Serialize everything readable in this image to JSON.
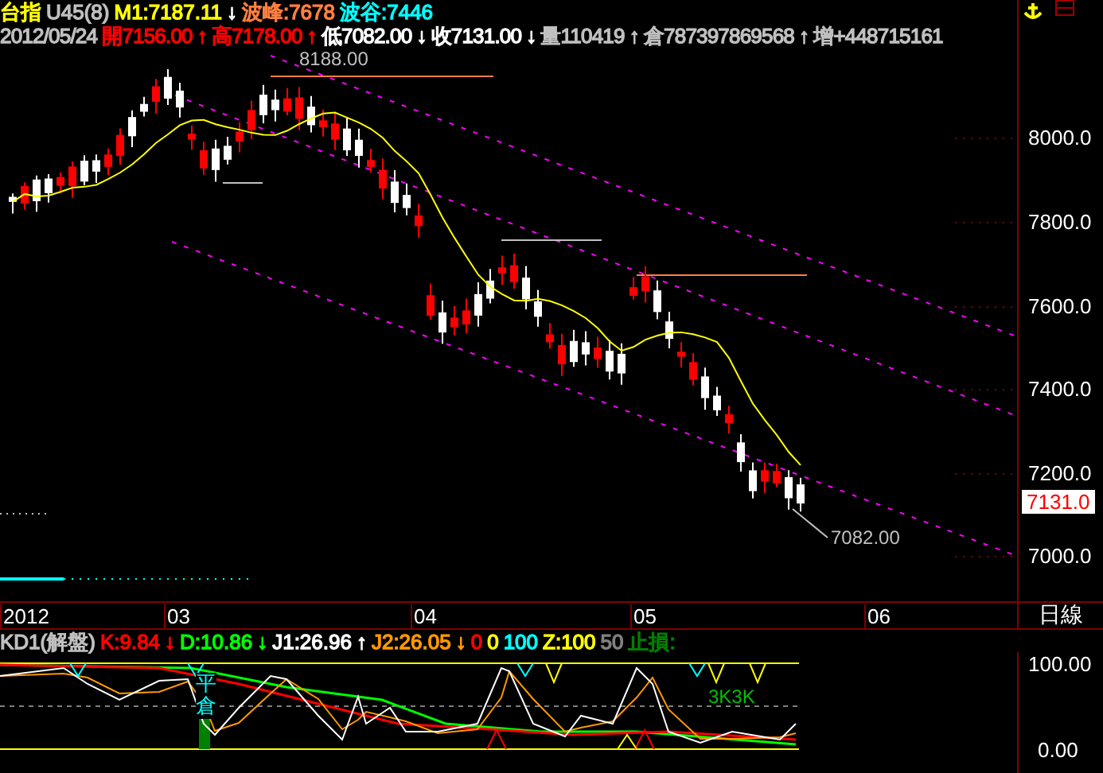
{
  "header": {
    "row1": [
      {
        "text": "台指",
        "color": "#ffff00"
      },
      {
        "text": "U45(8)",
        "color": "#c0c0c0"
      },
      {
        "text": "M1:7187.11",
        "color": "#ffff00"
      },
      {
        "text": "↓",
        "color": "#ffffff"
      },
      {
        "text": "波峰:7678",
        "color": "#ff8040"
      },
      {
        "text": "波谷:7446",
        "color": "#00ffff"
      }
    ],
    "row2": [
      {
        "text": "2012/05/24",
        "color": "#c0c0c0"
      },
      {
        "text": "開7156.00",
        "color": "#ff0000"
      },
      {
        "text": "↑",
        "color": "#ff0000"
      },
      {
        "text": "高7178.00",
        "color": "#ff0000"
      },
      {
        "text": "↑",
        "color": "#ff0000"
      },
      {
        "text": "低7082.00",
        "color": "#ffffff"
      },
      {
        "text": "↓",
        "color": "#ffffff"
      },
      {
        "text": "收7131.00",
        "color": "#ffffff"
      },
      {
        "text": "↓",
        "color": "#ffffff"
      },
      {
        "text": "量110419",
        "color": "#c0c0c0"
      },
      {
        "text": "↑",
        "color": "#c0c0c0"
      },
      {
        "text": "倉787397869568",
        "color": "#c0c0c0"
      },
      {
        "text": "↑",
        "color": "#c0c0c0"
      },
      {
        "text": "增+448715161",
        "color": "#c0c0c0"
      }
    ]
  },
  "price_axis": {
    "labels": [
      "8000.0",
      "7800.0",
      "7600.0",
      "7400.0",
      "7200.0",
      "7000.0"
    ],
    "last_price": "7131.0"
  },
  "annotations": {
    "high_label": "8188.00",
    "low_label": "7082.00"
  },
  "time_axis": {
    "labels": [
      "2012",
      "03",
      "04",
      "05",
      "06"
    ],
    "period": "日線"
  },
  "kd_panel": {
    "header": [
      {
        "text": "KD1(解盤)",
        "color": "#c0c0c0"
      },
      {
        "text": "K:9.84",
        "color": "#ff0000"
      },
      {
        "text": "↓",
        "color": "#ff0000"
      },
      {
        "text": "D:10.86",
        "color": "#00ff00"
      },
      {
        "text": "↓",
        "color": "#00ff00"
      },
      {
        "text": "J1:26.96",
        "color": "#ffffff"
      },
      {
        "text": "↑",
        "color": "#ffffff"
      },
      {
        "text": "J2:26.05",
        "color": "#ff9900"
      },
      {
        "text": "↓",
        "color": "#ff9900"
      },
      {
        "text": "0",
        "color": "#ff0000"
      },
      {
        "text": "0",
        "color": "#ffff00"
      },
      {
        "text": "100",
        "color": "#00ffff"
      },
      {
        "text": "Z:100",
        "color": "#ffff00"
      },
      {
        "text": "50",
        "color": "#808080"
      },
      {
        "text": "止損:",
        "color": "#008000"
      }
    ],
    "axis": [
      "100.00",
      "0.00"
    ],
    "close_signal": "平倉",
    "k_signal": "3K3K"
  }
}
